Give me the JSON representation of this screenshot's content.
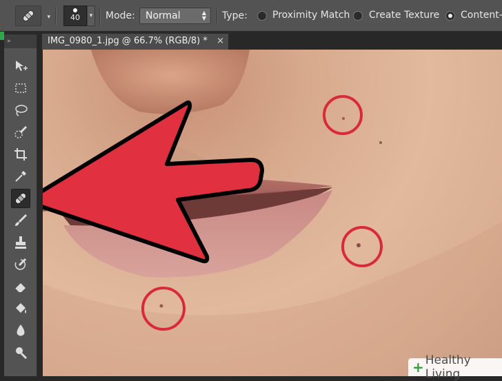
{
  "options_bar": {
    "brush_size": "40",
    "mode_label": "Mode:",
    "mode_value": "Normal",
    "type_label": "Type:",
    "type_options": [
      {
        "label": "Proximity Match",
        "selected": false
      },
      {
        "label": "Create Texture",
        "selected": false
      },
      {
        "label": "Content-A",
        "selected": true
      }
    ]
  },
  "document": {
    "tab_title": "IMG_0980_1.jpg @ 66.7% (RGB/8) *",
    "close_glyph": "×"
  },
  "toolbox": {
    "header_glyph": "»",
    "tools": [
      {
        "name": "move-tool-icon",
        "active": false
      },
      {
        "name": "marquee-tool-icon",
        "active": false
      },
      {
        "name": "lasso-tool-icon",
        "active": false
      },
      {
        "name": "quick-selection-tool-icon",
        "active": false
      },
      {
        "name": "crop-tool-icon",
        "active": false
      },
      {
        "name": "eyedropper-tool-icon",
        "active": false
      },
      {
        "name": "spot-healing-brush-tool-icon",
        "active": true
      },
      {
        "name": "brush-tool-icon",
        "active": false
      },
      {
        "name": "clone-stamp-tool-icon",
        "active": false
      },
      {
        "name": "history-brush-tool-icon",
        "active": false
      },
      {
        "name": "eraser-tool-icon",
        "active": false
      },
      {
        "name": "paint-bucket-tool-icon",
        "active": false
      },
      {
        "name": "blur-tool-icon",
        "active": false
      },
      {
        "name": "dodge-tool-icon",
        "active": false
      }
    ]
  },
  "annotation": {
    "arrow_color": "#e1303f",
    "circle_color": "#d92a3a"
  },
  "watermark": {
    "plus": "+",
    "text": "Healthy Living"
  }
}
